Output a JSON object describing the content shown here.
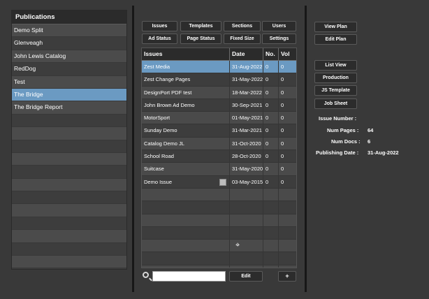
{
  "publications": {
    "header": "Publications",
    "items": [
      {
        "label": "Demo Split"
      },
      {
        "label": "Glenveagh"
      },
      {
        "label": "John Lewis Catalog"
      },
      {
        "label": "RedDog"
      },
      {
        "label": "Test"
      },
      {
        "label": "The Bridge",
        "selected": true
      },
      {
        "label": "The Bridge Report"
      }
    ],
    "empty_rows": 13
  },
  "toolbar": {
    "issues": "Issues",
    "templates": "Templates",
    "sections": "Sections",
    "users": "Users",
    "ad_status": "Ad Status",
    "page_status": "Page Status",
    "fixed_size": "Fixed Size",
    "settings": "Settings"
  },
  "table": {
    "columns": [
      "Issues",
      "Date",
      "No.",
      "Vol"
    ],
    "rows": [
      {
        "issue": "Zest Media",
        "date": "31-Aug-2022",
        "no": "0",
        "vol": "0",
        "selected": true
      },
      {
        "issue": "Zest Change Pages",
        "date": "31-May-2022",
        "no": "0",
        "vol": "0"
      },
      {
        "issue": "DesignPort PDF test",
        "date": "18-Mar-2022",
        "no": "0",
        "vol": "0"
      },
      {
        "issue": "John Brown Ad Demo",
        "date": "30-Sep-2021",
        "no": "0",
        "vol": "0"
      },
      {
        "issue": "MotorSport",
        "date": "01-May-2021",
        "no": "0",
        "vol": "0"
      },
      {
        "issue": "Sunday Demo",
        "date": "31-Mar-2021",
        "no": "0",
        "vol": "0"
      },
      {
        "issue": "Catalog Demo JL",
        "date": "31-Oct-2020",
        "no": "0",
        "vol": "0"
      },
      {
        "issue": "School Road",
        "date": "28-Oct-2020",
        "no": "0",
        "vol": "0"
      },
      {
        "issue": "Suitcase",
        "date": "31-May-2020",
        "no": "0",
        "vol": "0"
      },
      {
        "issue": "Demo Issue",
        "date": "03-May-2015",
        "no": "0",
        "vol": "0",
        "doc_icon": true
      }
    ],
    "empty_rows": 7
  },
  "search": {
    "placeholder": "",
    "value": ""
  },
  "bottom": {
    "edit": "Edit",
    "add": "+"
  },
  "right_buttons": {
    "view_plan": "View Plan",
    "edit_plan": "Edit Plan",
    "list_view": "List View",
    "production": "Production",
    "js_template": "JS Template",
    "job_sheet": "Job Sheet"
  },
  "info": {
    "issue_number_label": "Issue Number :",
    "issue_number_value": "",
    "num_pages_label": "Num Pages :",
    "num_pages_value": "64",
    "num_docs_label": "Num Docs :",
    "num_docs_value": "6",
    "publishing_date_label": "Publishing Date :",
    "publishing_date_value": "31-Aug-2022"
  },
  "colors": {
    "selection": "#6b9ac2",
    "background": "#393939"
  }
}
